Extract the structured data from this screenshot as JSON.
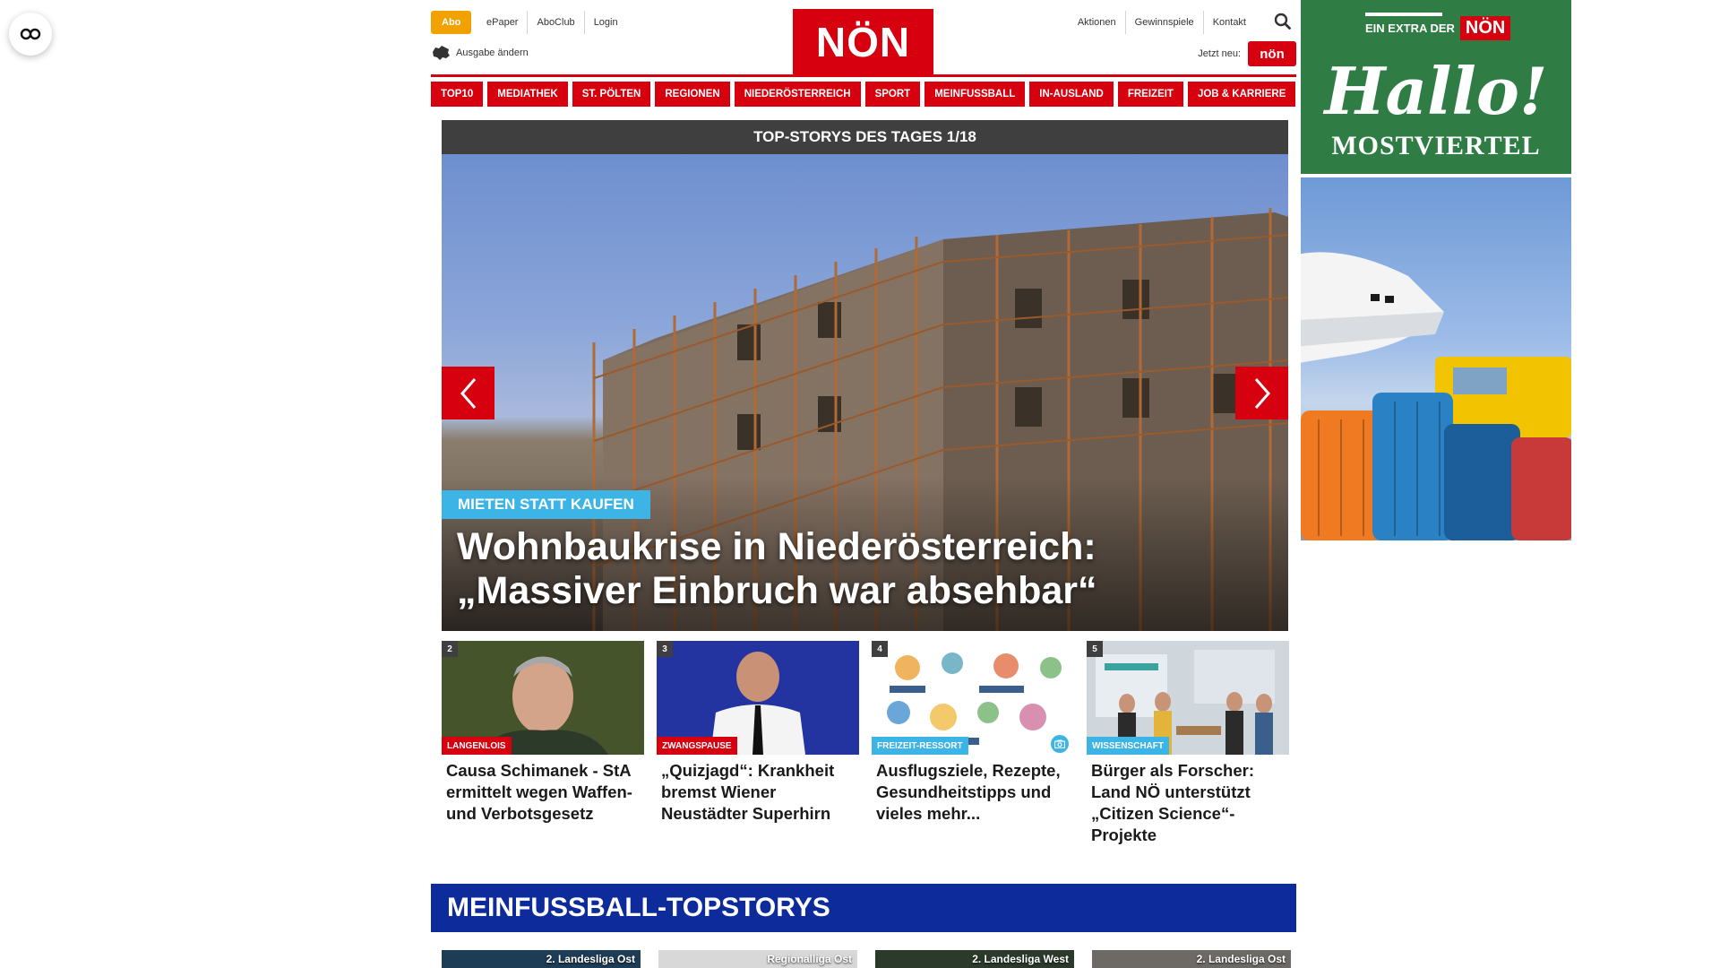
{
  "header": {
    "abo_label": "Abo",
    "top_links_left": [
      "ePaper",
      "AboClub",
      "Login"
    ],
    "edition_label": "Ausgabe ändern",
    "logo_text": "NÖN",
    "top_links_right": [
      "Aktionen",
      "Gewinnspiele",
      "Kontakt"
    ],
    "jetzt_neu_label": "Jetzt neu:",
    "mini_logo_text": "nön"
  },
  "nav": {
    "items": [
      "TOP10",
      "MEDIATHEK",
      "ST. PÖLTEN",
      "REGIONEN",
      "NIEDERÖSTERREICH",
      "SPORT",
      "MEINFUSSBALL",
      "IN-AUSLAND",
      "FREIZEIT",
      "JOB & KARRIERE"
    ]
  },
  "slider": {
    "header": "TOP-STORYS DES TAGES 1/18",
    "kicker": "MIETEN STATT KAUFEN",
    "title": "Wohnbaukrise in Niederösterreich: „Massiver Einbruch war absehbar“"
  },
  "teasers": [
    {
      "num": "2",
      "tag": "LANGENLOIS",
      "tag_color": "#d6000f",
      "title": "Causa Schimanek - StA ermittelt wegen Waffen- und Verbotsgesetz"
    },
    {
      "num": "3",
      "tag": "ZWANGSPAUSE",
      "tag_color": "#d6000f",
      "title": "„Quizjagd“: Krankheit bremst Wiener Neustädter Superhirn"
    },
    {
      "num": "4",
      "tag": "FREIZEIT-RESSORT",
      "tag_color": "#3cb4e5",
      "title": "Ausflugsziele, Rezepte, Gesundheitstipps und vieles mehr..."
    },
    {
      "num": "5",
      "tag": "WISSENSCHAFT",
      "tag_color": "#3cb4e5",
      "title": "Bürger als Forscher: Land NÖ unterstützt „Citizen Science“-Projekte"
    }
  ],
  "meinfussball": {
    "heading": "MEINFUSSBALL-TOPSTORYS",
    "cards": [
      "2. Landesliga Ost",
      "Regionalliga Ost",
      "2. Landesliga West",
      "2. Landesliga Ost"
    ]
  },
  "ads": {
    "ad1_extra": "EIN EXTRA DER",
    "ad1_logo": "NÖN",
    "ad1_hallo": "Hallo!",
    "ad1_sub": "MOSTVIERTEL"
  },
  "colors": {
    "brand_red": "#d6000f",
    "abo_orange": "#f2a200",
    "kicker_blue": "#3cb4e5",
    "fussball_blue": "#0e2b9b",
    "ad_green": "#2f7d45"
  },
  "icons": [
    "accessibility-icon",
    "edition-map-icon",
    "search-icon",
    "chevron-left-icon",
    "chevron-right-icon",
    "camera-icon"
  ]
}
